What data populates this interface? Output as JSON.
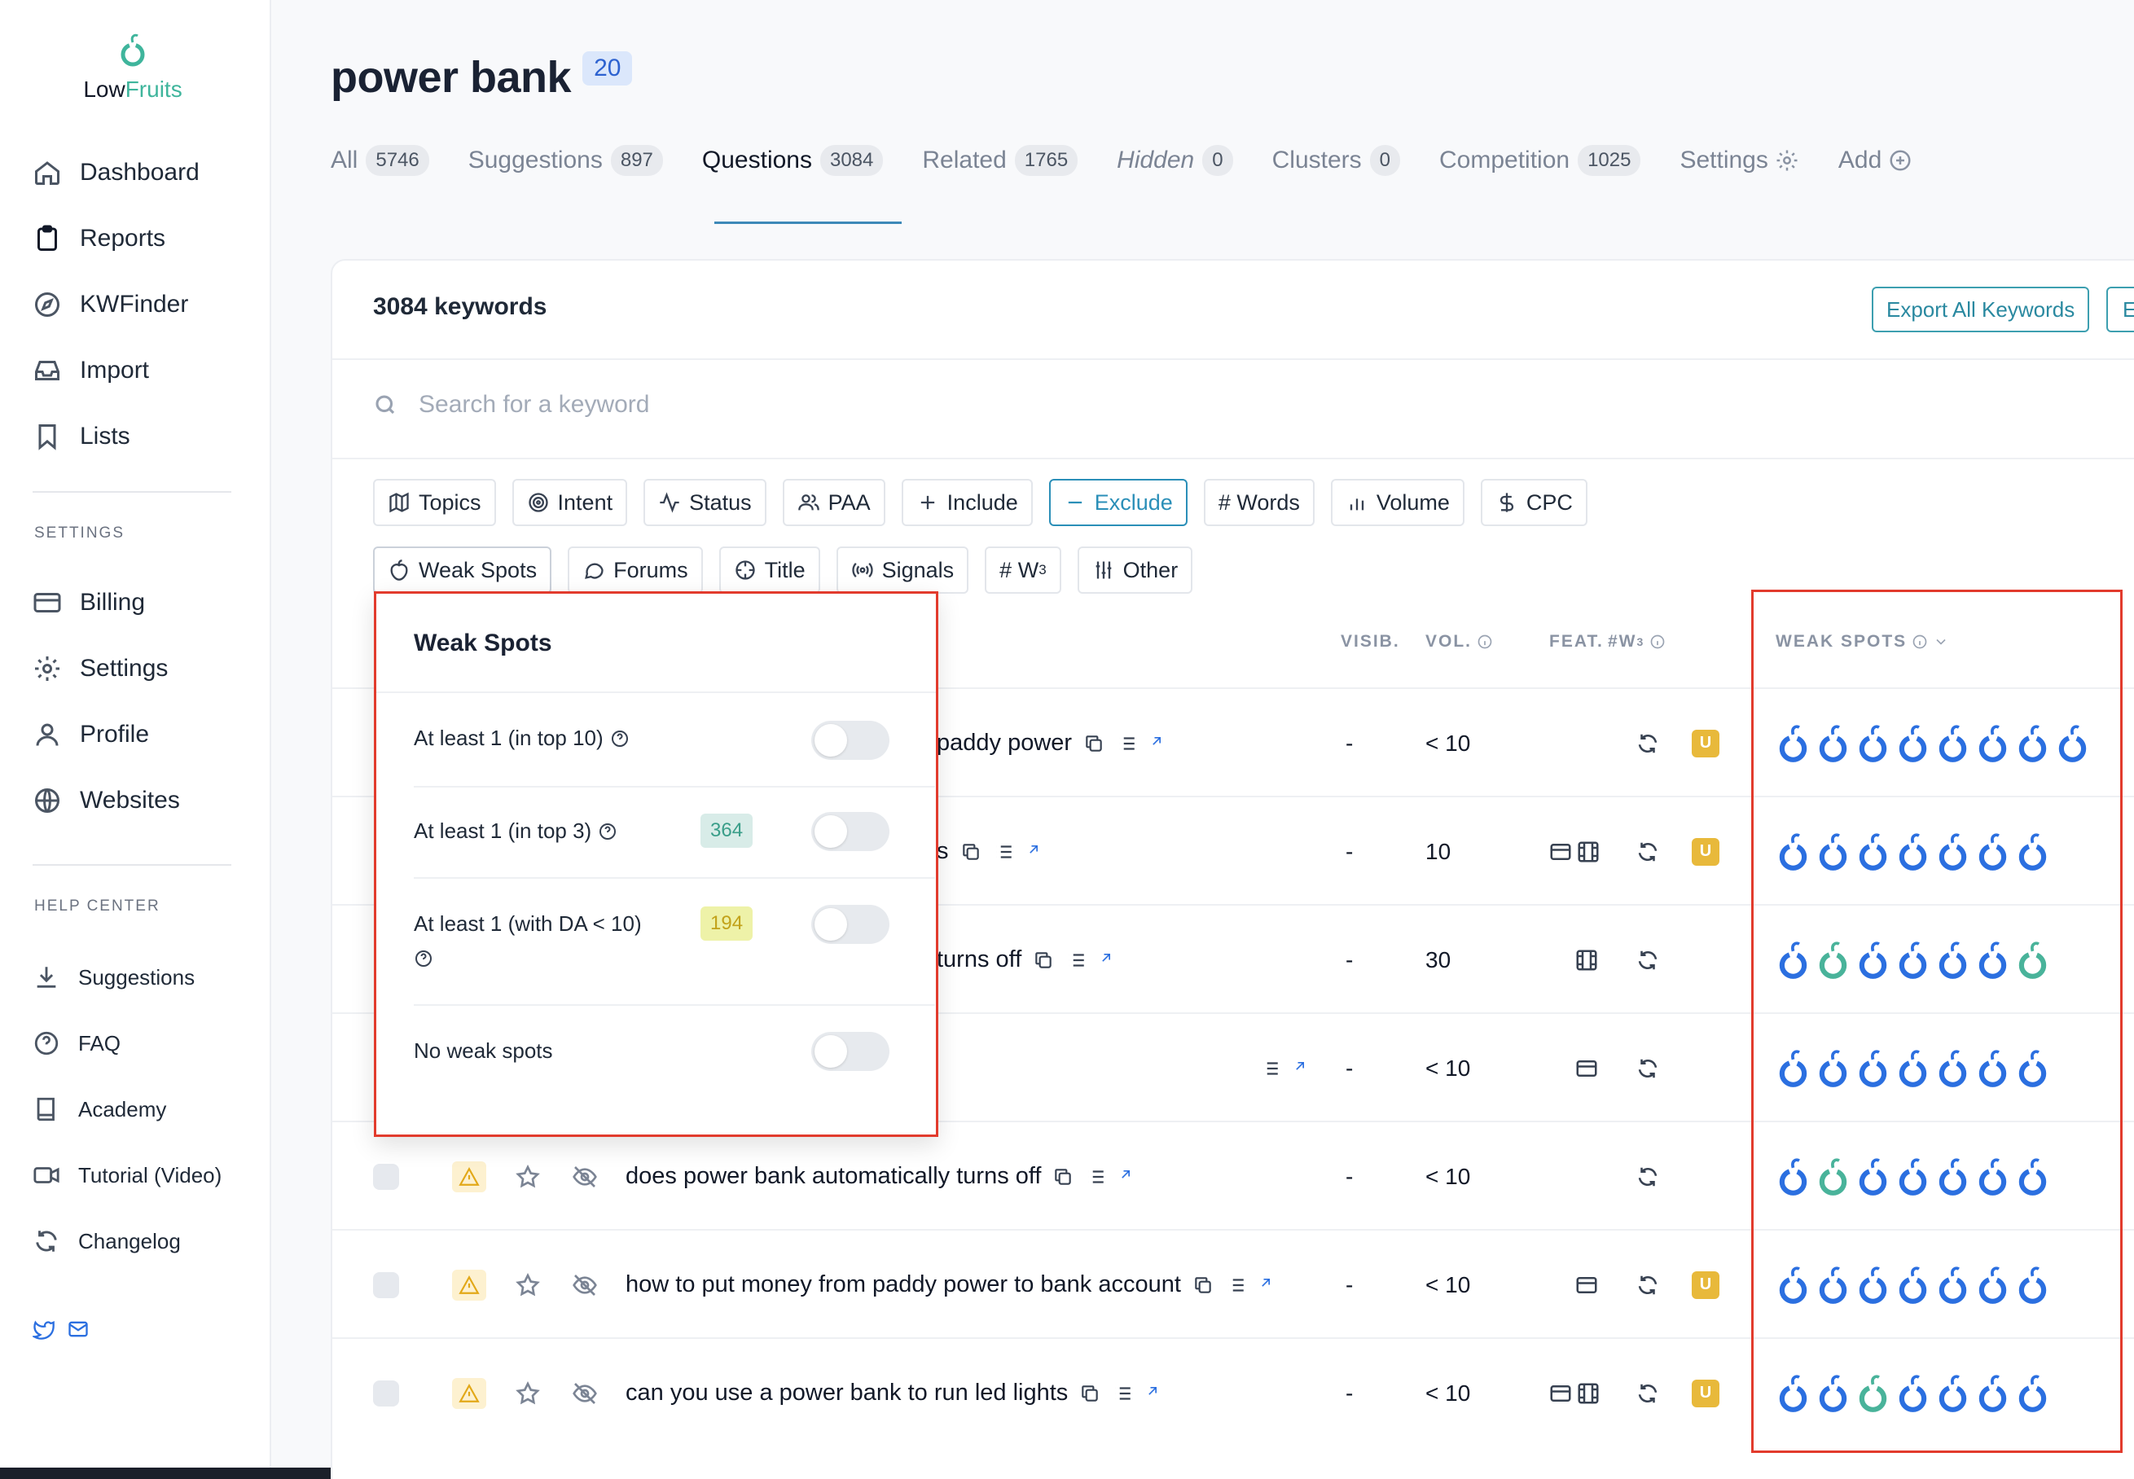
{
  "brand": {
    "name_part1": "Low",
    "name_part2": "Fruits"
  },
  "sidebar": {
    "main": [
      {
        "label": "Dashboard",
        "icon": "home-icon"
      },
      {
        "label": "Reports",
        "icon": "clipboard-icon"
      },
      {
        "label": "KWFinder",
        "icon": "compass-icon"
      },
      {
        "label": "Import",
        "icon": "inbox-icon"
      },
      {
        "label": "Lists",
        "icon": "bookmark-icon"
      }
    ],
    "settings_heading": "SETTINGS",
    "settings": [
      {
        "label": "Billing",
        "icon": "credit-card-icon"
      },
      {
        "label": "Settings",
        "icon": "gear-icon"
      },
      {
        "label": "Profile",
        "icon": "user-icon"
      },
      {
        "label": "Websites",
        "icon": "globe-icon"
      }
    ],
    "help_heading": "HELP CENTER",
    "help": [
      {
        "label": "Suggestions",
        "icon": "download-icon"
      },
      {
        "label": "FAQ",
        "icon": "help-circle-icon"
      },
      {
        "label": "Academy",
        "icon": "book-icon"
      },
      {
        "label": "Tutorial (Video)",
        "icon": "video-icon"
      },
      {
        "label": "Changelog",
        "icon": "refresh-icon"
      }
    ]
  },
  "header": {
    "title": "power bank",
    "badge": "20"
  },
  "tabs": [
    {
      "label": "All",
      "count": "5746"
    },
    {
      "label": "Suggestions",
      "count": "897"
    },
    {
      "label": "Questions",
      "count": "3084"
    },
    {
      "label": "Related",
      "count": "1765"
    },
    {
      "label": "Hidden",
      "count": "0"
    },
    {
      "label": "Clusters",
      "count": "0"
    },
    {
      "label": "Competition",
      "count": "1025"
    },
    {
      "label": "Settings",
      "count": ""
    },
    {
      "label": "Add",
      "count": ""
    }
  ],
  "card": {
    "keyword_count": "3084 keywords",
    "export_label": "Export All Keywords",
    "export2_label": "E",
    "search_placeholder": "Search for a keyword"
  },
  "filters_row1": [
    "Topics",
    "Intent",
    "Status",
    "PAA",
    "Include",
    "Exclude",
    "# Words",
    "Volume",
    "CPC"
  ],
  "filters_row2": [
    "Weak Spots",
    "Forums",
    "Title",
    "Signals",
    "# W",
    "Other"
  ],
  "filters_w_sup": "3",
  "table_headers": {
    "visib": "VISIB.",
    "vol": "VOL.",
    "feat": "FEAT.",
    "w3": "#W",
    "w3_sup": "3",
    "weak_spots": "WEAK SPOTS"
  },
  "rows": [
    {
      "keyword": "paddy power",
      "visib": "-",
      "vol": "< 10",
      "u": "U"
    },
    {
      "keyword": "s",
      "visib": "-",
      "vol": "10",
      "u": "U"
    },
    {
      "keyword": "turns off",
      "visib": "-",
      "vol": "30",
      "u": ""
    },
    {
      "keyword": "",
      "visib": "-",
      "vol": "< 10",
      "u": ""
    },
    {
      "keyword": "does power bank automatically turns off",
      "visib": "-",
      "vol": "< 10",
      "u": ""
    },
    {
      "keyword": "how to put money from paddy power to bank account",
      "visib": "-",
      "vol": "< 10",
      "u": "U"
    },
    {
      "keyword": "can you use a power bank to run led lights",
      "visib": "-",
      "vol": "< 10",
      "u": "U"
    }
  ],
  "weak_spots_popup": {
    "title": "Weak Spots",
    "options": [
      {
        "label": "At least 1 (in top 10)",
        "count": "",
        "on": false
      },
      {
        "label": "At least 1 (in top 3)",
        "count": "364",
        "on": false
      },
      {
        "label": "At least 1 (with DA  < 10)",
        "count": "194",
        "on": false
      },
      {
        "label": "No weak spots",
        "count": "",
        "on": false
      }
    ]
  },
  "colors": {
    "accent": "#2b8fb8",
    "brand_green": "#3fb59c",
    "fruit_blue": "#2b6fe0",
    "fruit_green": "#49b39a",
    "highlight": "#e23b2d"
  }
}
